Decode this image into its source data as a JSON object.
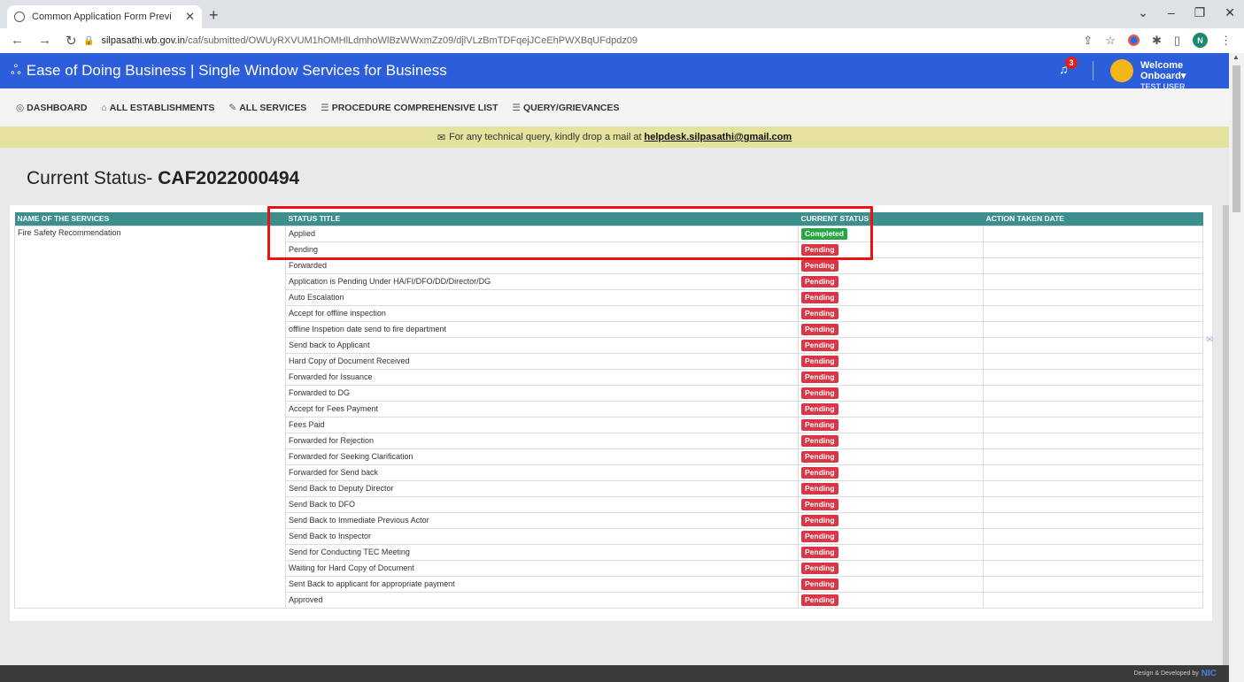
{
  "browser": {
    "tab_title": "Common Application Form Previ",
    "url_host": "silpasathi.wb.gov.in",
    "url_path": "/caf/submitted/OWUyRXVUM1hOMHlLdmhoWlBzWWxmZz09/djlVLzBmTDFqejJCeEhPWXBqUFdpdz09",
    "profile_initial": "N"
  },
  "header": {
    "brand": "Ease of Doing Business | Single Window Services for Business",
    "notification_count": "3",
    "welcome": "Welcome Onboard",
    "user": "TEST USER"
  },
  "menu": [
    {
      "label": "DASHBOARD",
      "icon": "dashboard-icon"
    },
    {
      "label": "ALL ESTABLISHMENTS",
      "icon": "building-icon"
    },
    {
      "label": "ALL SERVICES",
      "icon": "wrench-icon"
    },
    {
      "label": "PROCEDURE COMPREHENSIVE LIST",
      "icon": "list-icon"
    },
    {
      "label": "QUERY/GRIEVANCES",
      "icon": "list-icon"
    }
  ],
  "notice": {
    "text": "For any technical query, kindly drop a mail at",
    "email": "helpdesk.silpasathi@gmail.com"
  },
  "page": {
    "title_prefix": "Current Status-",
    "caf_id": "CAF2022000494"
  },
  "table": {
    "headers": [
      "NAME OF THE SERVICES",
      "STATUS TITLE",
      "CURRENT STATUS",
      "ACTION TAKEN DATE"
    ],
    "service_name": "Fire Safety Recommendation",
    "rows": [
      {
        "title": "Applied",
        "status": "Completed"
      },
      {
        "title": "Pending",
        "status": "Pending"
      },
      {
        "title": "Forwarded",
        "status": "Pending"
      },
      {
        "title": "Application is Pending Under HA/FI/DFO/DD/Director/DG",
        "status": "Pending"
      },
      {
        "title": "Auto Escalation",
        "status": "Pending"
      },
      {
        "title": "Accept for offline inspection",
        "status": "Pending"
      },
      {
        "title": "offline Inspetion date send to fire department",
        "status": "Pending"
      },
      {
        "title": "Send back to Applicant",
        "status": "Pending"
      },
      {
        "title": "Hard Copy of Document Received",
        "status": "Pending"
      },
      {
        "title": "Forwarded for Issuance",
        "status": "Pending"
      },
      {
        "title": "Forwarded to DG",
        "status": "Pending"
      },
      {
        "title": "Accept for Fees Payment",
        "status": "Pending"
      },
      {
        "title": "Fees Paid",
        "status": "Pending"
      },
      {
        "title": "Forwarded for Rejection",
        "status": "Pending"
      },
      {
        "title": "Forwarded for Seeking Clarification",
        "status": "Pending"
      },
      {
        "title": "Forwarded for Send back",
        "status": "Pending"
      },
      {
        "title": "Send Back to Deputy Director",
        "status": "Pending"
      },
      {
        "title": "Send Back to DFO",
        "status": "Pending"
      },
      {
        "title": "Send Back to Immediate Previous Actor",
        "status": "Pending"
      },
      {
        "title": "Send Back to Inspector",
        "status": "Pending"
      },
      {
        "title": "Send for Conducting TEC Meeting",
        "status": "Pending"
      },
      {
        "title": "Waiting for Hard Copy of Document",
        "status": "Pending"
      },
      {
        "title": "Sent Back to applicant for appropriate payment",
        "status": "Pending"
      },
      {
        "title": "Approved",
        "status": "Pending"
      }
    ]
  },
  "footer": {
    "text": "Design & Developed by",
    "org": "NIC"
  },
  "colors": {
    "header_blue": "#2c5ddb",
    "table_header": "#3d8f8d",
    "pending": "#dc3545",
    "completed": "#28a745",
    "notice_bg": "#e4e29c"
  }
}
